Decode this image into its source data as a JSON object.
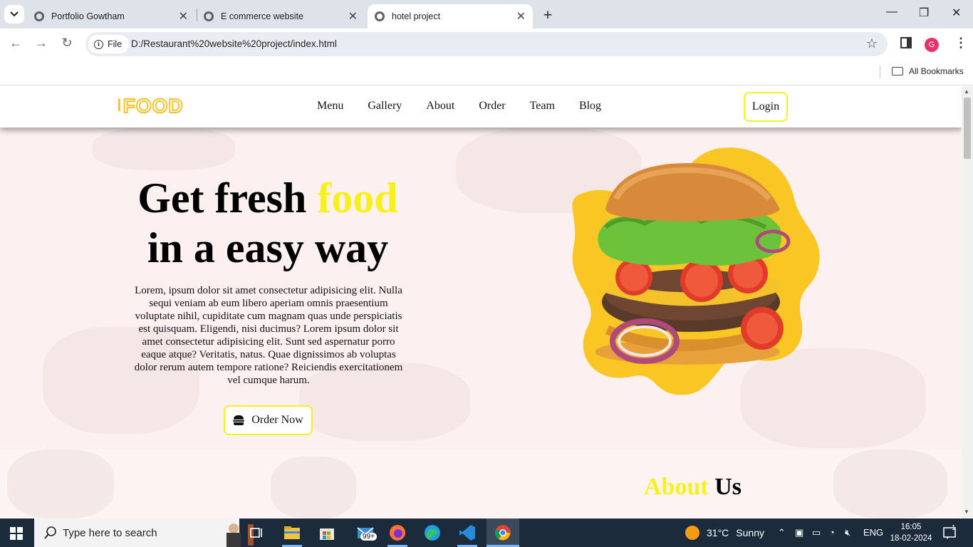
{
  "browser": {
    "tabs": [
      {
        "title": "Portfolio Gowtham",
        "active": false
      },
      {
        "title": "E commerce website",
        "active": false
      },
      {
        "title": "hotel project",
        "active": true
      }
    ],
    "address": {
      "scheme_chip": "File",
      "url": "D:/Restaurant%20website%20project/index.html"
    },
    "profile_initial": "G",
    "bookmarks_label": "All Bookmarks"
  },
  "site": {
    "logo_text": "FOOD",
    "nav": [
      "Menu",
      "Gallery",
      "About",
      "Order",
      "Team",
      "Blog"
    ],
    "login_label": "Login",
    "hero": {
      "title_part1": "Get fresh ",
      "title_highlight": "food",
      "title_part2": "in a easy way",
      "description": "Lorem, ipsum dolor sit amet consectetur adipisicing elit. Nulla sequi veniam ab eum libero aperiam omnis praesentium voluptate nihil, cupiditate cum magnam quas unde perspiciatis est quisquam. Eligendi, nisi ducimus? Lorem ipsum dolor sit amet consectetur adipisicing elit. Sunt sed aspernatur porro eaque atque? Veritatis, natus. Quae dignissimos ab voluptas dolor rerum autem tempore ratione? Reiciendis exercitationem vel cumque harum.",
      "order_label": "Order Now"
    },
    "about": {
      "title_highlight": "About",
      "title_rest": " Us"
    },
    "colors": {
      "accent_yellow": "#f8f01a",
      "logo_gold": "#f6c22b",
      "hero_bg": "#fcf1f0"
    }
  },
  "taskbar": {
    "search_placeholder": "Type here to search",
    "mail_badge": "99+",
    "weather": {
      "temp": "31°C",
      "condition": "Sunny"
    },
    "language": "ENG",
    "time": "16:05",
    "date": "18-02-2024",
    "notification_count": "1"
  }
}
